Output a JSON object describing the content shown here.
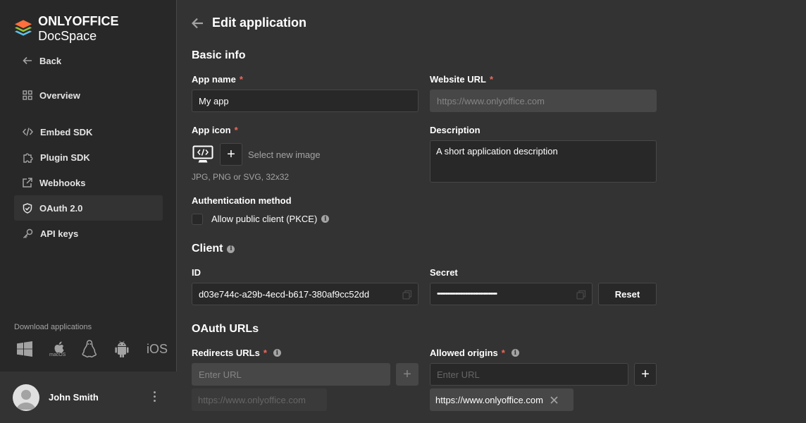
{
  "brand": {
    "name_bold": "ONLYOFFICE",
    "name_regular": "DocSpace"
  },
  "sidebar": {
    "back": "Back",
    "items": [
      {
        "label": "Overview",
        "icon": "grid-icon"
      },
      {
        "label": "Embed SDK",
        "icon": "code-icon"
      },
      {
        "label": "Plugin SDK",
        "icon": "puzzle-icon"
      },
      {
        "label": "Webhooks",
        "icon": "external-link-icon"
      },
      {
        "label": "OAuth 2.0",
        "icon": "shield-check-icon",
        "active": true
      },
      {
        "label": "API keys",
        "icon": "key-icon"
      }
    ],
    "download_label": "Download applications",
    "download_apps": [
      "windows-icon",
      "macos-icon",
      "linux-icon",
      "android-icon",
      "ios-icon"
    ],
    "macos_caption": "macOS",
    "ios_text": "iOS"
  },
  "profile": {
    "name": "John Smith"
  },
  "header": {
    "title": "Edit application"
  },
  "basic_info": {
    "title": "Basic info",
    "app_name_label": "App name",
    "app_name_value": "My app",
    "website_url_label": "Website URL",
    "website_url_placeholder": "https://www.onlyoffice.com",
    "app_icon_label": "App icon",
    "select_image": "Select new image",
    "icon_hint": "JPG, PNG or SVG, 32x32",
    "description_label": "Description",
    "description_value": "A short application description",
    "auth_method_label": "Authentication method",
    "pkce_label": "Allow public client (PKCE)"
  },
  "client": {
    "title": "Client",
    "id_label": "ID",
    "id_value": "d03e744c-a29b-4ecd-b617-380af9cc52dd",
    "secret_label": "Secret",
    "secret_value": "••••••••••••••••••••••••••••••••••••",
    "reset_label": "Reset"
  },
  "oauth_urls": {
    "title": "OAuth URLs",
    "redirects_label": "Redirects URLs",
    "redirects_placeholder": "Enter URL",
    "redirects_chip": "https://www.onlyoffice.com",
    "origins_label": "Allowed origins",
    "origins_placeholder": "Enter URL",
    "origins_chip": "https://www.onlyoffice.com"
  },
  "colors": {
    "accent_required": "#f2665a",
    "sidebar_bg": "#282828",
    "main_bg": "#333333"
  }
}
